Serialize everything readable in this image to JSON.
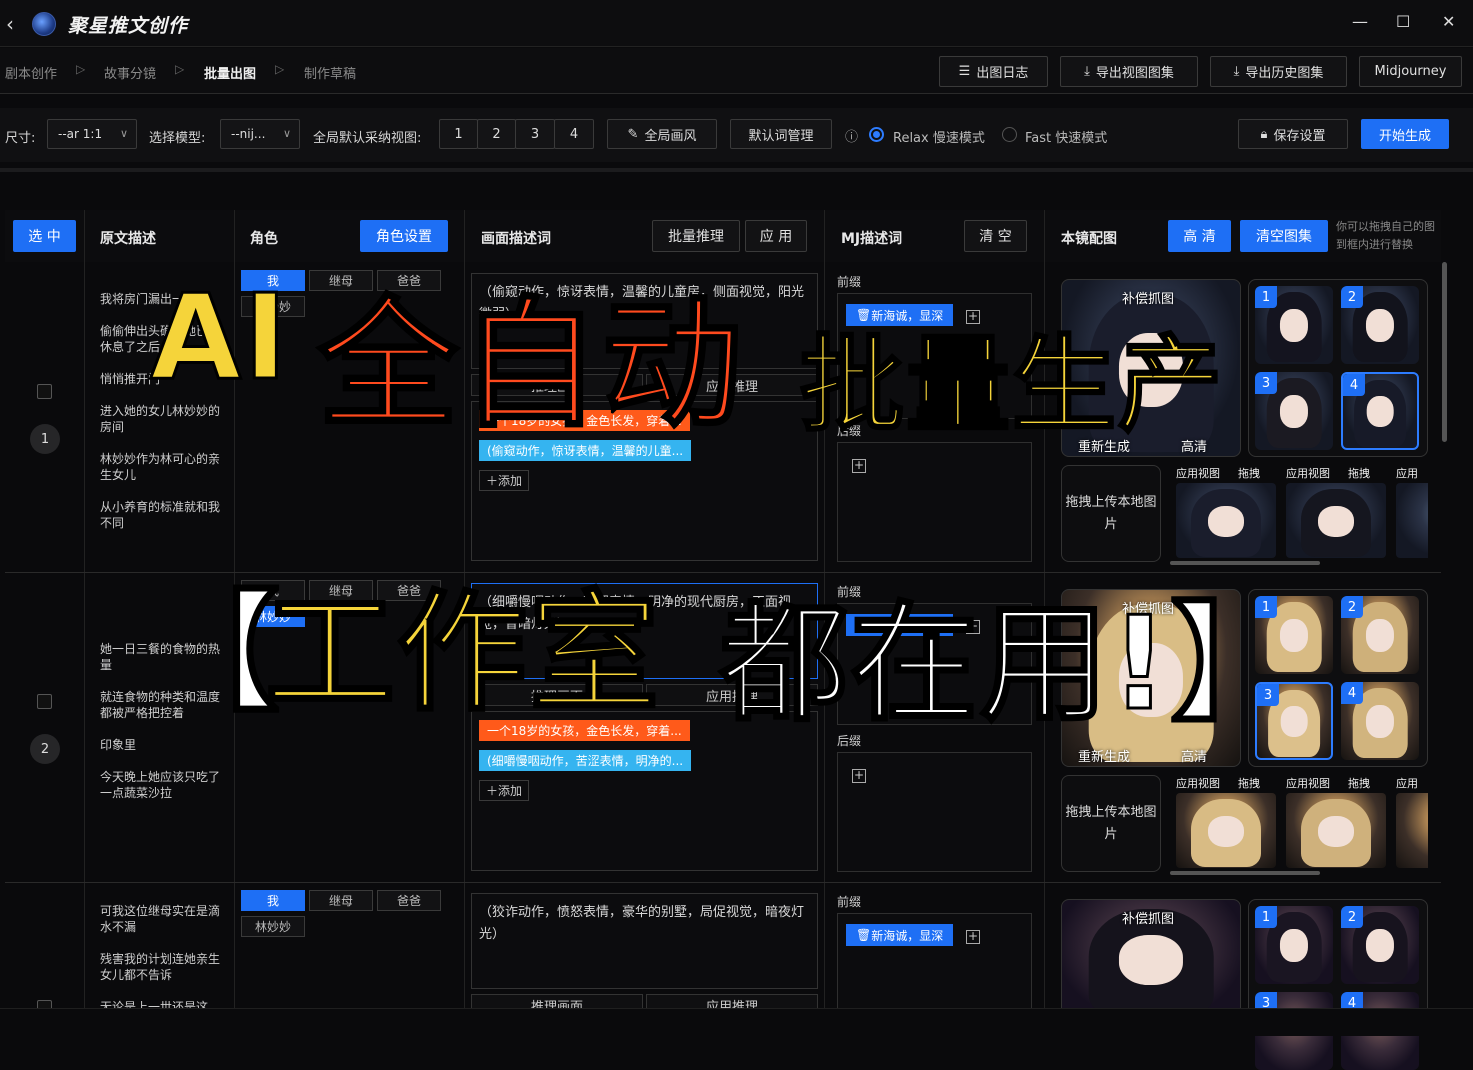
{
  "app": {
    "title": "聚星推文创作",
    "window_controls": [
      "—",
      "☐",
      "✕"
    ]
  },
  "nav": {
    "crumbs": [
      "剧本创作",
      "故事分镜",
      "批量出图",
      "制作草稿"
    ],
    "active_index": 2,
    "buttons": {
      "log": "出图日志",
      "export_view": "导出视图图集",
      "export_history": "导出历史图集",
      "engine": "Midjourney"
    }
  },
  "toolbar": {
    "size_label": "尺寸:",
    "size_value": "--ar 1:1",
    "model_label": "选择模型:",
    "model_value": "--nij...",
    "view_label": "全局默认采纳视图:",
    "view_options": [
      "1",
      "2",
      "3",
      "4"
    ],
    "global_style": "全局画风",
    "prompt_manage": "默认词管理",
    "mode_relax": "Relax 慢速模式",
    "mode_fast": "Fast 快速模式",
    "selected_mode": "relax",
    "save": "保存设置",
    "start": "开始生成"
  },
  "table": {
    "select_all": "选 中",
    "col_desc": "原文描述",
    "col_role": "角色",
    "role_settings": "角色设置",
    "col_prompt": "画面描述词",
    "batch_infer": "批量推理",
    "apply": "应 用",
    "col_mj": "MJ描述词",
    "clear": "清 空",
    "col_image": "本镜配图",
    "hd": "高 清",
    "clear_gallery": "清空图集",
    "hint": "你可以拖拽自己的图到框内进行替换"
  },
  "common": {
    "infer_btn": "推理画面",
    "apply_infer": "应用推理",
    "add": "添加",
    "prefix": "前缀",
    "suffix": "后缀",
    "fill_image": "补偿抓图",
    "regenerate": "重新生成",
    "hd_small": "高清",
    "upload": "拖拽上传本地图片",
    "apply_view": "应用视图",
    "drag": "拖拽"
  },
  "rows": [
    {
      "num": "1",
      "desc": [
        "我将房门漏出一条缝",
        "偷偷伸出头确认她已经休息了之后",
        "悄悄推开门",
        "进入她的女儿林妙妙的房间",
        "林妙妙作为林可心的亲生女儿",
        "从小养育的标准就和我不同"
      ],
      "roles": [
        "我",
        "继母",
        "爸爸",
        "林妙妙"
      ],
      "role_selected": [
        0
      ],
      "prompt": "（偷窥动作，惊讶表情，温馨的儿童房，侧面视觉，阳光微弱）",
      "tags": [
        {
          "text": "一个18岁的女孩，金色长发，穿着...",
          "color": "orange"
        },
        {
          "text": "(偷窥动作，惊讶表情，温馨的儿童...",
          "color": "cyan"
        }
      ],
      "mj_tag": "新海诚，显深"
    },
    {
      "num": "2",
      "desc": [
        "她一日三餐的食物的热量",
        "就连食物的种类和温度都被严格把控着",
        "印象里",
        "今天晚上她应该只吃了一点蔬菜沙拉"
      ],
      "roles": [
        "我",
        "继母",
        "爸爸",
        "林妙妙"
      ],
      "role_selected": [
        3
      ],
      "prompt": "（细嚼慢咽动作，苦涩表情，明净的现代厨房，正面视觉，昏暗灯光）",
      "tags": [
        {
          "text": "一个18岁的女孩，金色长发，穿着...",
          "color": "orange"
        },
        {
          "text": "(细嚼慢咽动作，苦涩表情，明净的...",
          "color": "cyan"
        }
      ],
      "mj_tag": "新海诚，显深"
    },
    {
      "num": "3",
      "desc": [
        "可我这位继母实在是滴水不漏",
        "残害我的计划连她亲生女儿都不告诉",
        "无论是上一世还是这"
      ],
      "roles": [
        "我",
        "继母",
        "爸爸",
        "林妙妙"
      ],
      "role_selected": [
        0
      ],
      "prompt": "（狡诈动作，愤怒表情，豪华的别墅，局促视觉，暗夜灯光）",
      "mj_tag": "新海诚，显深"
    }
  ],
  "overlay": {
    "line1_a": "AI",
    "line1_b": "全自动",
    "line1_c": "批量生产",
    "line2_a": "【",
    "line2_b": "工作室",
    "line2_c": "都在用!】"
  }
}
